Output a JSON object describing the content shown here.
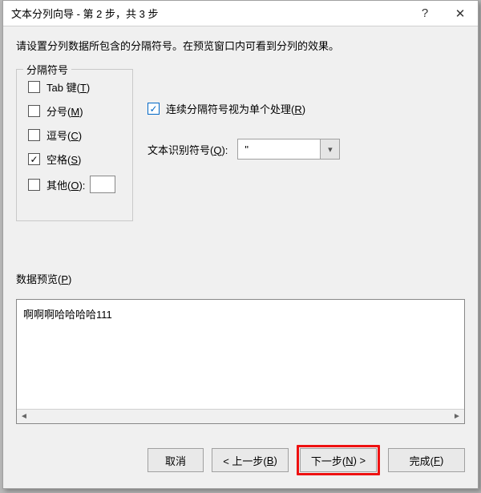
{
  "titlebar": {
    "title": "文本分列向导 - 第 2 步，共 3 步",
    "help": "?",
    "close": "✕"
  },
  "instruction": "请设置分列数据所包含的分隔符号。在预览窗口内可看到分列的效果。",
  "delimiters": {
    "legend": "分隔符号",
    "tab_label": "Tab 键(T)",
    "semicolon_label": "分号(M)",
    "comma_label": "逗号(C)",
    "space_label": "空格(S)",
    "other_label": "其他(O):"
  },
  "consecutive_label": "连续分隔符号视为单个处理(R)",
  "qualifier": {
    "label": "文本识别符号(Q):",
    "value": "\""
  },
  "preview": {
    "label": "数据预览(P)",
    "text": "啊啊啊哈哈哈哈111"
  },
  "buttons": {
    "cancel": "取消",
    "back": "< 上一步(B)",
    "next": "下一步(N) >",
    "finish": "完成(F)"
  }
}
